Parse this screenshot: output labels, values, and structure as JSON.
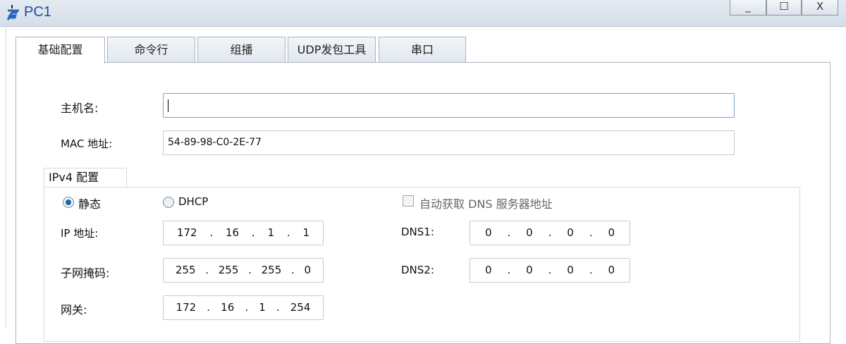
{
  "window": {
    "title": "PC1",
    "minimize": "_",
    "maximize": "☐",
    "close": "X"
  },
  "tabs": [
    {
      "label": "基础配置",
      "active": true
    },
    {
      "label": "命令行"
    },
    {
      "label": "组播"
    },
    {
      "label": "UDP发包工具"
    },
    {
      "label": "串口"
    }
  ],
  "basic": {
    "hostname_label": "主机名:",
    "hostname_value": "",
    "mac_label": "MAC 地址:",
    "mac_value": "54-89-98-C0-2E-77"
  },
  "ipv4": {
    "group_label": "IPv4 配置",
    "static_label": "静态",
    "static_selected": true,
    "dhcp_label": "DHCP",
    "auto_dns_label": "自动获取 DNS 服务器地址",
    "ip_label": "IP 地址:",
    "ip": [
      "172",
      "16",
      "1",
      "1"
    ],
    "mask_label": "子网掩码:",
    "mask": [
      "255",
      "255",
      "255",
      "0"
    ],
    "gateway_label": "网关:",
    "gateway": [
      "172",
      "16",
      "1",
      "254"
    ],
    "dns1_label": "DNS1:",
    "dns1": [
      "0",
      "0",
      "0",
      "0"
    ],
    "dns2_label": "DNS2:",
    "dns2": [
      "0",
      "0",
      "0",
      "0"
    ]
  }
}
